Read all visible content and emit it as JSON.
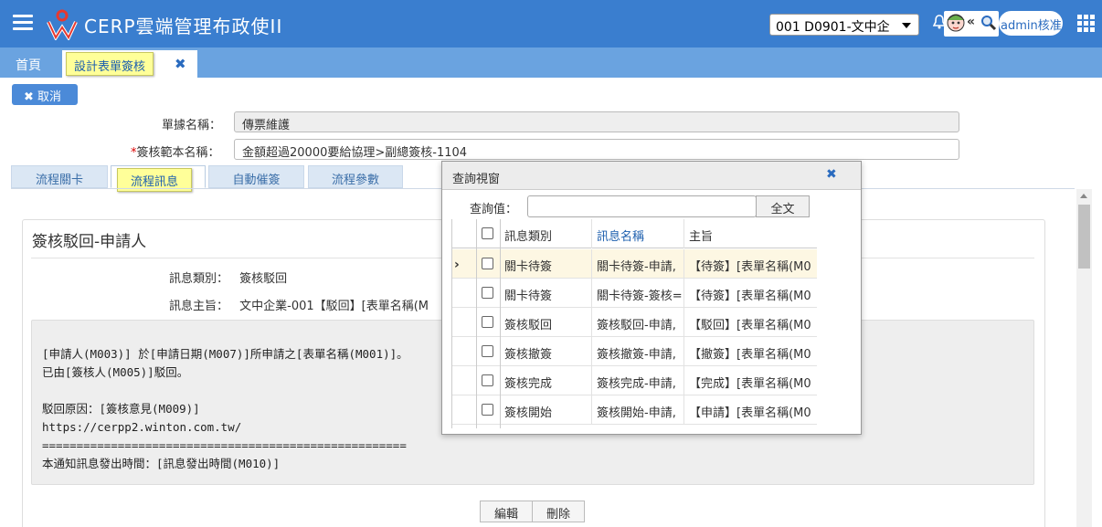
{
  "app": {
    "title": "CERP雲端管理布政使II"
  },
  "header": {
    "company_select": "001 D0901-文中企",
    "avatar_glyph": "«",
    "user": "admin核准"
  },
  "tabs": {
    "home": "首頁",
    "active": "設計表單簽核",
    "close": "✖"
  },
  "toolbar": {
    "cancel": "✖ 取消"
  },
  "form": {
    "doc_label": "單據名稱：",
    "doc_value": "傳票維護",
    "tpl_required": "*",
    "tpl_label": "簽核範本名稱：",
    "tpl_value": "金額超過20000要給協理>副總簽核-1104"
  },
  "section_tabs": [
    "流程關卡",
    "流程訊息",
    "自動催簽",
    "流程參數"
  ],
  "panel": {
    "title": "簽核駁回-申請人",
    "type_label": "訊息類別：",
    "type_value": "簽核駁回",
    "subject_label": "訊息主旨：",
    "subject_value": "文中企業-001【駁回】[表單名稱(M",
    "body": "[申請人(M003)] 於[申請日期(M007)]所申請之[表單名稱(M001)]。\n已由[簽核人(M005)]駁回。\n\n駁回原因：[簽核意見(M009)]\nhttps://cerpp2.winton.com.tw/\n=====================================================\n本通知訊息發出時間：[訊息發出時間(M010)]",
    "edit": "編輯",
    "delete": "刪除"
  },
  "dialog": {
    "title": "查詢視窗",
    "close": "✖",
    "query_label": "查詢值：",
    "full_text": "全文",
    "columns": [
      "訊息類別",
      "訊息名稱",
      "主旨"
    ],
    "rows": [
      {
        "type": "關卡待簽",
        "name": "關卡待簽-申請,",
        "subject": "【待簽】[表單名稱(M0"
      },
      {
        "type": "關卡待簽",
        "name": "關卡待簽-簽核=",
        "subject": "【待簽】[表單名稱(M0"
      },
      {
        "type": "簽核駁回",
        "name": "簽核駁回-申請,",
        "subject": "【駁回】[表單名稱(M0"
      },
      {
        "type": "簽核撤簽",
        "name": "簽核撤簽-申請,",
        "subject": "【撤簽】[表單名稱(M0"
      },
      {
        "type": "簽核完成",
        "name": "簽核完成-申請,",
        "subject": "【完成】[表單名稱(M0"
      },
      {
        "type": "簽核開始",
        "name": "簽核開始-申請,",
        "subject": "【申請】[表單名稱(M0"
      }
    ]
  },
  "colors": {
    "topbar": "#3a7ecf",
    "tabstrip": "#6aa3e0",
    "highlight": "#ffff99",
    "link": "#1d5fae"
  }
}
